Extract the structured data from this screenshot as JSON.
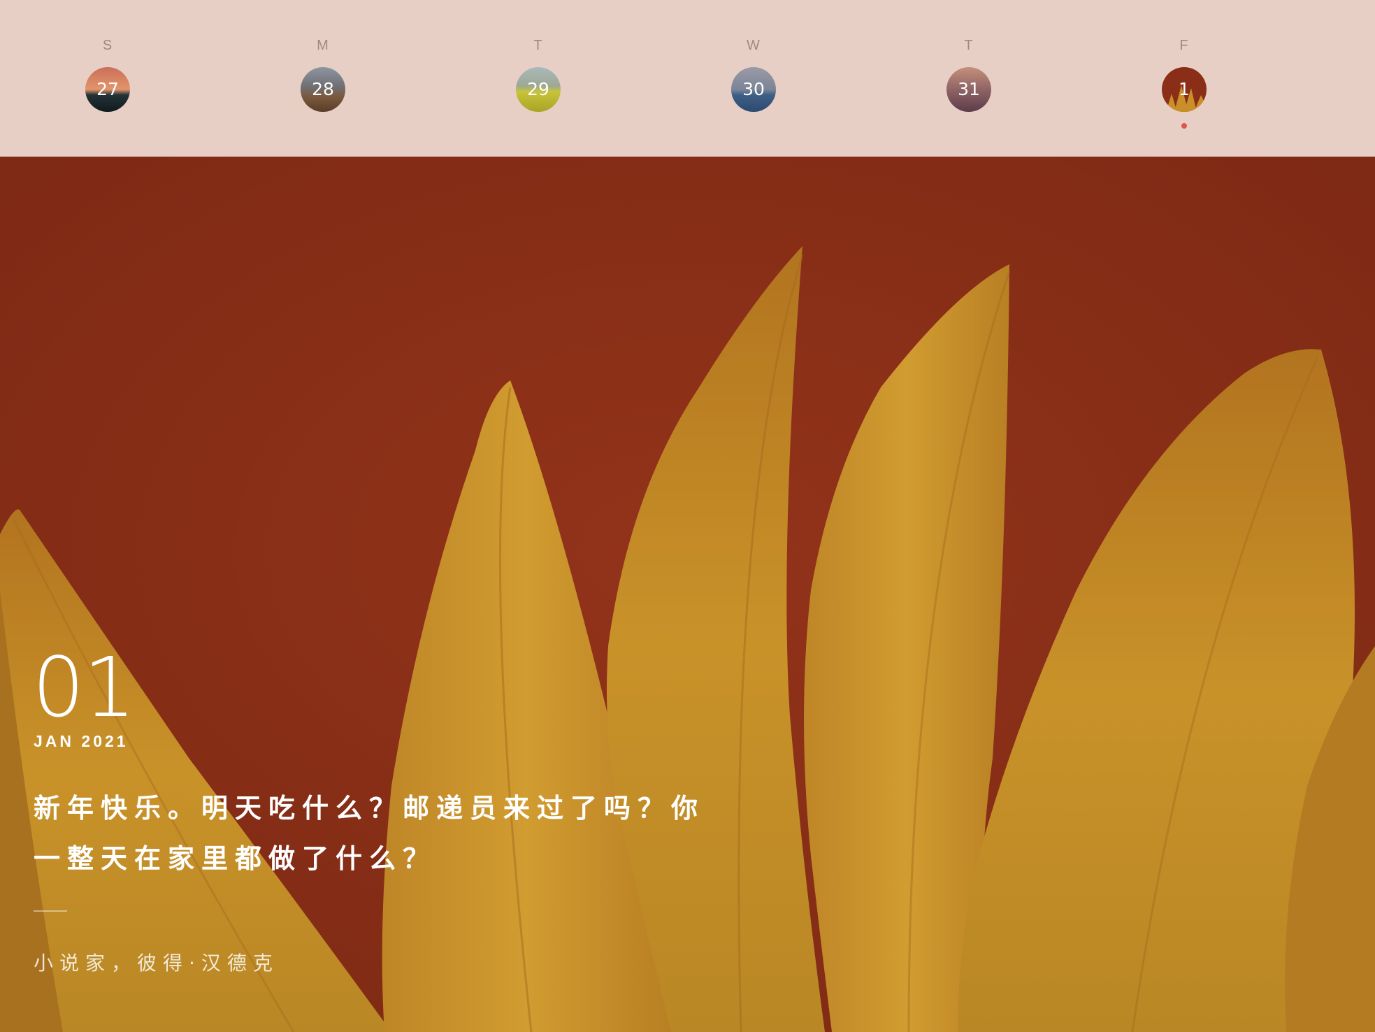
{
  "week": {
    "days": [
      {
        "letter": "S",
        "date": "27"
      },
      {
        "letter": "M",
        "date": "28"
      },
      {
        "letter": "T",
        "date": "29"
      },
      {
        "letter": "W",
        "date": "30"
      },
      {
        "letter": "T",
        "date": "31"
      },
      {
        "letter": "F",
        "date": "1",
        "selected": true
      }
    ]
  },
  "entry": {
    "day": "01",
    "month_year": "JAN 2021",
    "quote_line1": "新年快乐。明天吃什么？邮递员来过了吗？你",
    "quote_line2": "一整天在家里都做了什么？",
    "author": "小说家，彼得·汉德克"
  },
  "colors": {
    "header_bg": "#e8cfc6",
    "hero_bg": "#8a2e17",
    "petal": "#c9902a",
    "today_dot": "#e0554a"
  }
}
